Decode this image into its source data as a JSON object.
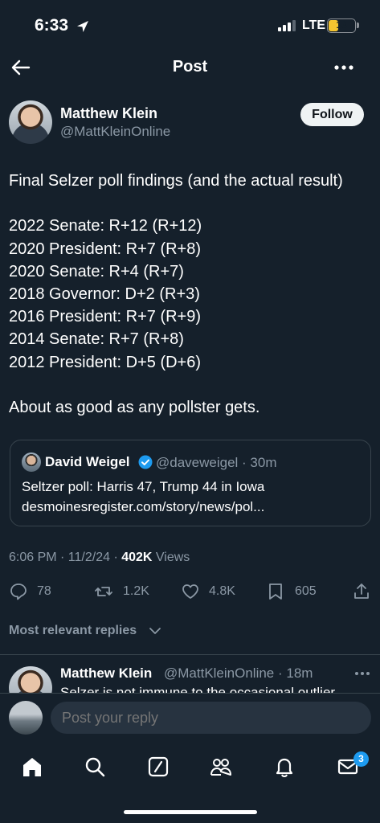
{
  "status": {
    "time": "6:33",
    "network": "LTE",
    "battery": "13"
  },
  "header": {
    "title": "Post"
  },
  "author": {
    "name": "Matthew Klein",
    "handle": "@MattKleinOnline",
    "follow_label": "Follow"
  },
  "post": {
    "lines": [
      "Final Selzer poll findings (and the actual result)",
      "",
      "2022 Senate: R+12 (R+12)",
      "2020 President: R+7 (R+8)",
      "2020 Senate: R+4 (R+7)",
      "2018 Governor: D+2 (R+3)",
      "2016 President: R+7 (R+9)",
      "2014 Senate: R+7 (R+8)",
      "2012 President: D+5 (D+6)",
      "",
      "About as good as any pollster gets."
    ]
  },
  "quote": {
    "name": "David Weigel",
    "handle_time": "@daveweigel · 30m",
    "line1": "Seltzer poll: Harris 47, Trump 44 in Iowa",
    "line2": "desmoinesregister.com/story/news/pol..."
  },
  "meta": {
    "time_date": "6:06 PM · 11/2/24 · ",
    "views_count": "402K",
    "views_label": " Views"
  },
  "actions": {
    "replies": "78",
    "reposts": "1.2K",
    "likes": "4.8K",
    "bookmarks": "605"
  },
  "replies_filter": "Most relevant replies",
  "reply": {
    "name": "Matthew Klein",
    "handle_time": "@MattKleinOnline · 18m",
    "text": "Selzer is not immune to the occasional outlier"
  },
  "composer": {
    "placeholder": "Post your reply"
  },
  "tabbar": {
    "messages_badge": "3"
  },
  "colors": {
    "background": "#15202b",
    "accent": "#1d9bf0",
    "muted": "#8b98a5",
    "border": "#38444d"
  }
}
